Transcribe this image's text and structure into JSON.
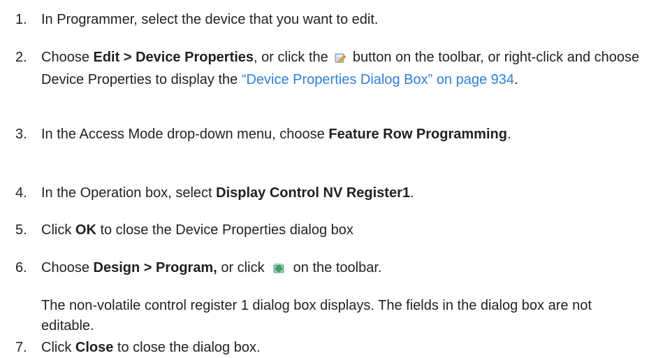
{
  "steps": [
    {
      "num": "1.",
      "text": "In Programmer, select the device that you want to edit."
    },
    {
      "num": "2.",
      "pre": "Choose ",
      "bold": "Edit > Device Properties",
      "mid": ", or click the ",
      "icon": "edit-properties-icon",
      "post": " button on the toolbar, or right-click and choose Device Properties to display the ",
      "link": "“Device Properties Dialog Box” on page 934",
      "end": "."
    },
    {
      "num": "3.",
      "pre": "In the Access Mode drop-down menu, choose ",
      "bold": "Feature Row Programming",
      "end": "."
    },
    {
      "num": "4.",
      "pre": "In the Operation box, select ",
      "bold": "Display Control NV Register1",
      "end": "."
    },
    {
      "num": "5.",
      "pre": "Click ",
      "bold": "OK",
      "post": " to close the Device Properties dialog box"
    },
    {
      "num": "6.",
      "pre": "Choose ",
      "bold": "Design > Program,",
      "mid": " or click ",
      "icon": "program-download-icon",
      "post": " on the toolbar."
    },
    {
      "num": "7.",
      "pre": "Click ",
      "bold": "Close",
      "post": " to close the dialog box."
    }
  ],
  "step6_note": "The non-volatile control register 1 dialog box displays. The fields in the dialog box are not editable.",
  "colors": {
    "text": "#231f20",
    "link": "#2f7fd8"
  }
}
